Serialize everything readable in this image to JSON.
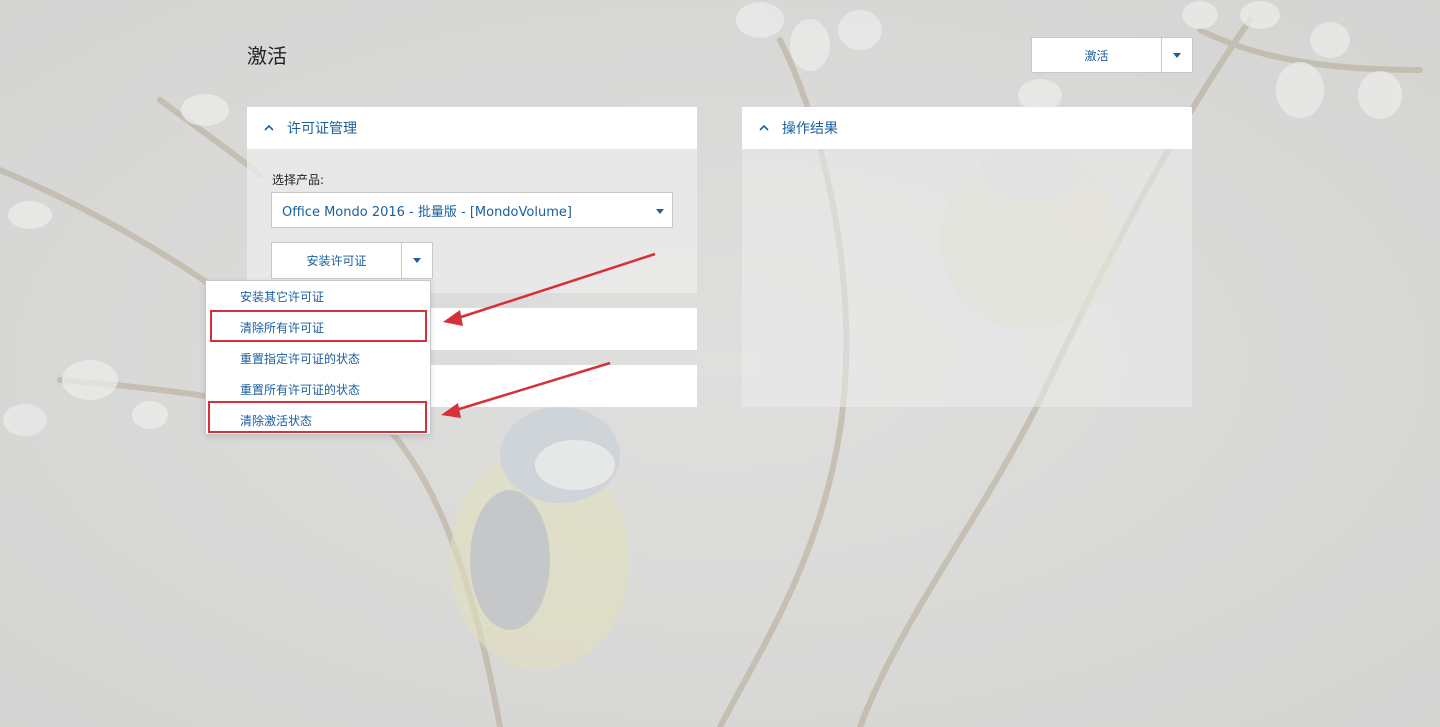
{
  "header": {
    "title": "激活",
    "activate_label": "激活"
  },
  "license_panel": {
    "title": "许可证管理",
    "select_label": "选择产品:",
    "selected_product": "Office Mondo 2016 - 批量版 - [MondoVolume]",
    "install_label": "安装许可证"
  },
  "dropdown": {
    "items": [
      {
        "label": "安装其它许可证",
        "highlighted": false
      },
      {
        "label": "清除所有许可证",
        "highlighted": true
      },
      {
        "label": "重置指定许可证的状态",
        "highlighted": false
      },
      {
        "label": "重置所有许可证的状态",
        "highlighted": false
      },
      {
        "label": "清除激活状态",
        "highlighted": true
      }
    ]
  },
  "results_panel": {
    "title": "操作结果"
  },
  "colors": {
    "accent": "#1a5fa0",
    "annotation": "#d6303a"
  },
  "icons": {
    "collapse": "chevron-up-icon",
    "dropdown": "caret-down-icon"
  }
}
